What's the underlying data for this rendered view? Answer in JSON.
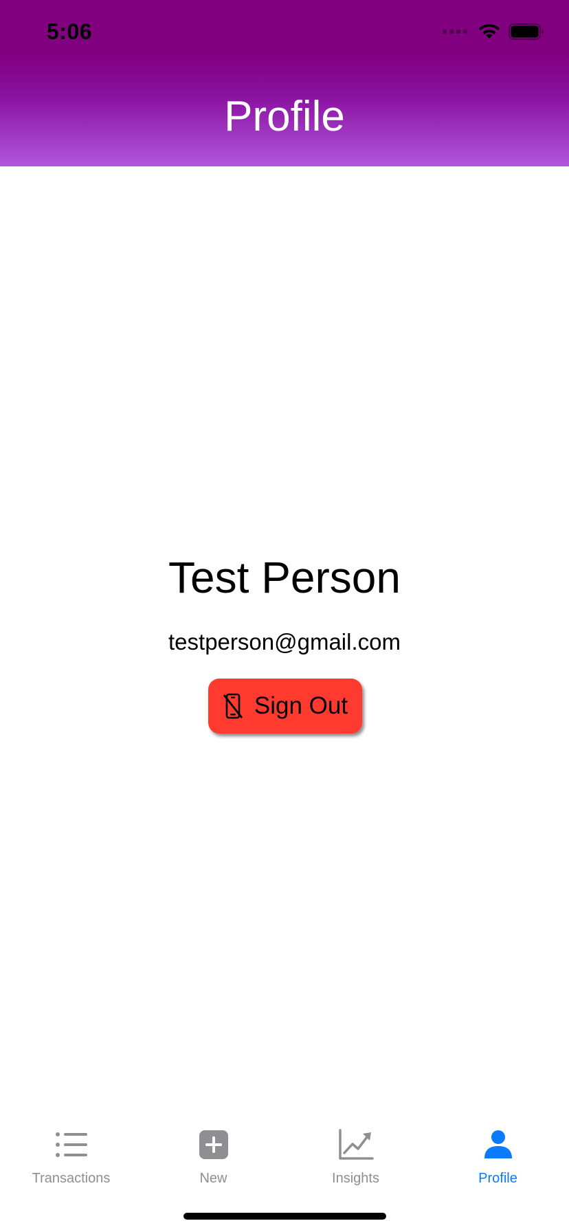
{
  "status_bar": {
    "time": "5:06"
  },
  "header": {
    "title": "Profile"
  },
  "profile": {
    "name": "Test Person",
    "email": "testperson@gmail.com",
    "sign_out_label": "Sign Out",
    "sign_out_icon": "phone-slash-icon"
  },
  "tab_bar": {
    "tabs": [
      {
        "label": "Transactions",
        "icon": "list-icon",
        "active": false
      },
      {
        "label": "New",
        "icon": "plus-square-icon",
        "active": false
      },
      {
        "label": "Insights",
        "icon": "chart-line-icon",
        "active": false
      },
      {
        "label": "Profile",
        "icon": "person-icon",
        "active": true
      }
    ]
  },
  "colors": {
    "header_gradient_top": "#800080",
    "header_gradient_bottom": "#b157dc",
    "sign_out_button": "#ff3b30",
    "tab_active": "#0a7aff",
    "tab_inactive": "#8e8e93"
  }
}
